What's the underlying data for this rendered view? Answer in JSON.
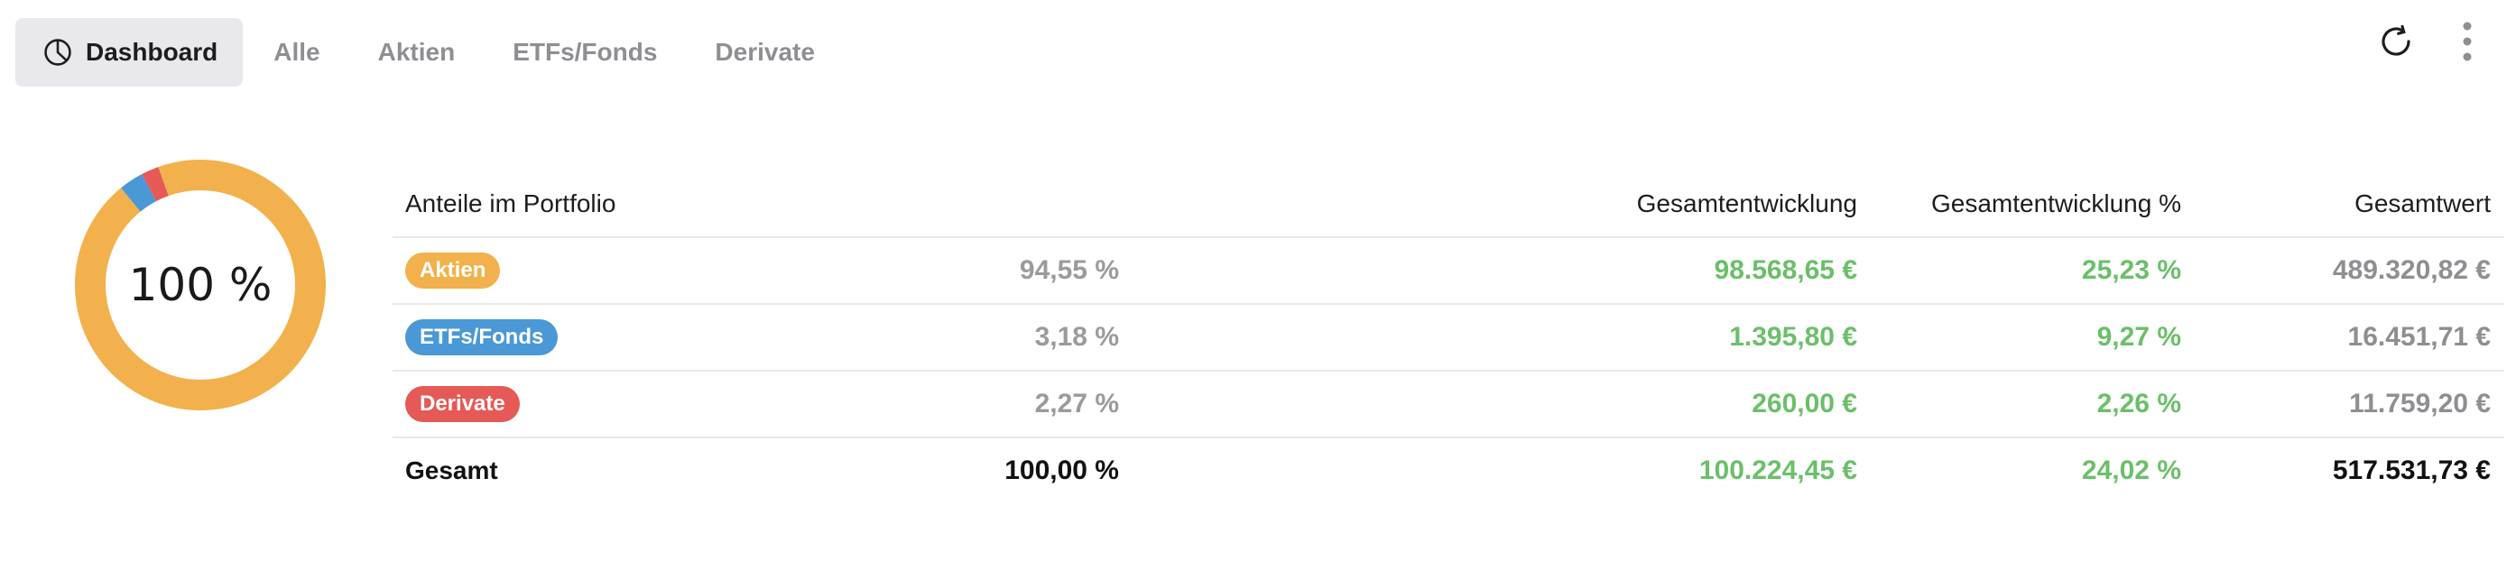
{
  "tabs": [
    {
      "label": "Dashboard",
      "icon": "pie-chart-icon",
      "active": true
    },
    {
      "label": "Alle"
    },
    {
      "label": "Aktien"
    },
    {
      "label": "ETFs/Fonds"
    },
    {
      "label": "Derivate"
    }
  ],
  "toolbar": {
    "refresh_icon": "refresh-icon",
    "more_icon": "more-vertical-icon"
  },
  "donut": {
    "center_label": "100 %",
    "segments": [
      {
        "name": "Aktien",
        "value": 94.55,
        "color": "#f2b14c"
      },
      {
        "name": "ETFs/Fonds",
        "value": 3.18,
        "color": "#4a98d6"
      },
      {
        "name": "Derivate",
        "value": 2.27,
        "color": "#e55a56"
      }
    ]
  },
  "table": {
    "headers": {
      "share": "Anteile im Portfolio",
      "dev": "Gesamtentwicklung",
      "dev_pct": "Gesamtentwicklung %",
      "total": "Gesamtwert"
    },
    "rows": [
      {
        "label": "Aktien",
        "color": "#f2b14c",
        "pct": "94,55 %",
        "dev": "98.568,65 €",
        "dev_pct": "25,23 %",
        "total": "489.320,82 €"
      },
      {
        "label": "ETFs/Fonds",
        "color": "#4a98d6",
        "pct": "3,18 %",
        "dev": "1.395,80 €",
        "dev_pct": "9,27 %",
        "total": "16.451,71 €"
      },
      {
        "label": "Derivate",
        "color": "#e55a56",
        "pct": "2,27 %",
        "dev": "260,00 €",
        "dev_pct": "2,26 %",
        "total": "11.759,20 €"
      }
    ],
    "summary": {
      "label": "Gesamt",
      "pct": "100,00 %",
      "dev": "100.224,45 €",
      "dev_pct": "24,02 %",
      "total": "517.531,73 €"
    }
  },
  "colors": {
    "positive": "#6cbf6a",
    "active_tab_bg": "#e8e8ed"
  }
}
